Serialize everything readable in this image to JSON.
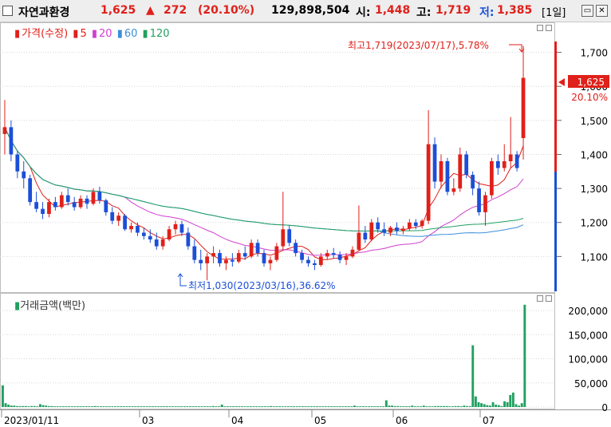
{
  "header": {
    "name": "자연과환경",
    "price": "1,625",
    "change_arrow": "▲",
    "change": "272",
    "change_pct": "(20.10%)",
    "volume": "129,898,504",
    "open_label": "시:",
    "open": "1,448",
    "high_label": "고:",
    "high": "1,719",
    "low_label": "저:",
    "low": "1,385",
    "period": "[1일]"
  },
  "legend": {
    "price_label": "가격(수정)",
    "ma": [
      "5",
      "20",
      "60",
      "120"
    ],
    "volume_label": "거래금액(백만)"
  },
  "annotations": {
    "high": "최고1,719(2023/07/17),5.78%",
    "low": "최저1,030(2023/03/16),36.62%",
    "current_price": "1,625",
    "current_pct": "20.10%"
  },
  "colors": {
    "up": "#e0201a",
    "down": "#1b4fd8",
    "ma5": "#e0201a",
    "ma20": "#d040d0",
    "ma60": "#3a8fd8",
    "ma120": "#22a060",
    "volume": "#22a060"
  },
  "chart_data": [
    {
      "type": "candlestick",
      "title": "가격(수정)",
      "y_ticks": [
        1100,
        1200,
        1300,
        1400,
        1500,
        1600,
        1700
      ],
      "ylim": [
        1000,
        1760
      ],
      "x_ticks": [
        "2023/01/11",
        "03",
        "04",
        "05",
        "06",
        "07"
      ],
      "series": [
        {
          "name": "5",
          "values": []
        },
        {
          "name": "20",
          "values": []
        },
        {
          "name": "60",
          "values": []
        },
        {
          "name": "120",
          "values": []
        }
      ],
      "key_points": [
        {
          "label": "최고",
          "date": "2023/07/17",
          "value": 1719
        },
        {
          "label": "최저",
          "date": "2023/03/16",
          "value": 1030
        },
        {
          "label": "현재가",
          "value": 1625
        }
      ],
      "candles": [
        [
          1460,
          1560,
          1400,
          1480
        ],
        [
          1480,
          1500,
          1380,
          1400
        ],
        [
          1400,
          1410,
          1330,
          1350
        ],
        [
          1350,
          1380,
          1300,
          1330
        ],
        [
          1330,
          1340,
          1250,
          1260
        ],
        [
          1260,
          1290,
          1230,
          1240
        ],
        [
          1240,
          1260,
          1210,
          1225
        ],
        [
          1225,
          1270,
          1215,
          1260
        ],
        [
          1260,
          1275,
          1235,
          1245
        ],
        [
          1245,
          1290,
          1240,
          1280
        ],
        [
          1280,
          1300,
          1250,
          1260
        ],
        [
          1260,
          1275,
          1235,
          1245
        ],
        [
          1245,
          1280,
          1240,
          1270
        ],
        [
          1270,
          1280,
          1240,
          1255
        ],
        [
          1255,
          1300,
          1250,
          1290
        ],
        [
          1290,
          1305,
          1255,
          1265
        ],
        [
          1265,
          1270,
          1220,
          1230
        ],
        [
          1230,
          1245,
          1195,
          1205
        ],
        [
          1205,
          1230,
          1190,
          1220
        ],
        [
          1220,
          1225,
          1175,
          1180
        ],
        [
          1180,
          1200,
          1170,
          1190
        ],
        [
          1190,
          1200,
          1160,
          1170
        ],
        [
          1170,
          1185,
          1150,
          1160
        ],
        [
          1160,
          1180,
          1140,
          1150
        ],
        [
          1150,
          1170,
          1120,
          1130
        ],
        [
          1130,
          1160,
          1120,
          1150
        ],
        [
          1150,
          1190,
          1145,
          1180
        ],
        [
          1180,
          1205,
          1165,
          1195
        ],
        [
          1195,
          1205,
          1160,
          1170
        ],
        [
          1170,
          1185,
          1120,
          1130
        ],
        [
          1130,
          1150,
          1080,
          1090
        ],
        [
          1090,
          1120,
          1060,
          1080
        ],
        [
          1080,
          1110,
          1030,
          1100
        ],
        [
          1100,
          1130,
          1080,
          1110
        ],
        [
          1110,
          1120,
          1070,
          1080
        ],
        [
          1080,
          1100,
          1060,
          1090
        ],
        [
          1090,
          1110,
          1070,
          1085
        ],
        [
          1085,
          1120,
          1080,
          1110
        ],
        [
          1110,
          1130,
          1090,
          1100
        ],
        [
          1100,
          1150,
          1095,
          1140
        ],
        [
          1140,
          1150,
          1100,
          1110
        ],
        [
          1110,
          1120,
          1070,
          1080
        ],
        [
          1080,
          1100,
          1060,
          1090
        ],
        [
          1090,
          1140,
          1085,
          1130
        ],
        [
          1130,
          1290,
          1120,
          1180
        ],
        [
          1180,
          1190,
          1130,
          1140
        ],
        [
          1140,
          1150,
          1100,
          1110
        ],
        [
          1110,
          1120,
          1080,
          1090
        ],
        [
          1090,
          1100,
          1070,
          1080
        ],
        [
          1080,
          1090,
          1060,
          1075
        ],
        [
          1075,
          1110,
          1070,
          1100
        ],
        [
          1100,
          1120,
          1090,
          1110
        ],
        [
          1110,
          1125,
          1095,
          1105
        ],
        [
          1105,
          1115,
          1080,
          1090
        ],
        [
          1090,
          1110,
          1075,
          1100
        ],
        [
          1100,
          1130,
          1095,
          1120
        ],
        [
          1120,
          1250,
          1115,
          1170
        ],
        [
          1170,
          1190,
          1140,
          1150
        ],
        [
          1150,
          1210,
          1145,
          1200
        ],
        [
          1200,
          1215,
          1170,
          1180
        ],
        [
          1180,
          1200,
          1160,
          1170
        ],
        [
          1170,
          1190,
          1160,
          1185
        ],
        [
          1185,
          1200,
          1165,
          1175
        ],
        [
          1175,
          1190,
          1165,
          1182
        ],
        [
          1182,
          1210,
          1175,
          1200
        ],
        [
          1200,
          1210,
          1180,
          1190
        ],
        [
          1190,
          1210,
          1182,
          1205
        ],
        [
          1205,
          1530,
          1195,
          1430
        ],
        [
          1430,
          1450,
          1300,
          1320
        ],
        [
          1320,
          1400,
          1300,
          1380
        ],
        [
          1380,
          1390,
          1280,
          1290
        ],
        [
          1290,
          1330,
          1280,
          1300
        ],
        [
          1300,
          1420,
          1290,
          1400
        ],
        [
          1400,
          1410,
          1330,
          1340
        ],
        [
          1340,
          1350,
          1280,
          1300
        ],
        [
          1300,
          1320,
          1220,
          1230
        ],
        [
          1230,
          1290,
          1190,
          1280
        ],
        [
          1280,
          1390,
          1270,
          1380
        ],
        [
          1380,
          1400,
          1340,
          1360
        ],
        [
          1360,
          1430,
          1350,
          1380
        ],
        [
          1380,
          1510,
          1360,
          1400
        ],
        [
          1400,
          1410,
          1350,
          1360
        ],
        [
          1448,
          1719,
          1385,
          1625
        ]
      ]
    },
    {
      "type": "bar",
      "title": "거래금액(백만)",
      "y_ticks": [
        0,
        50000,
        100000,
        150000,
        200000
      ],
      "ylim": [
        0,
        215000
      ],
      "values": [
        45000,
        8000,
        5000,
        3000,
        3000,
        2000,
        2000,
        2000,
        2000,
        1500,
        2000,
        2000,
        1500,
        6000,
        4000,
        3000,
        2000,
        2000,
        1500,
        1500,
        1500,
        1500,
        1500,
        1500,
        1500,
        1500,
        1500,
        1500,
        1500,
        1500,
        1500,
        1500,
        2000,
        1500,
        1500,
        1500,
        1500,
        1500,
        1500,
        1500,
        1500,
        1500,
        1500,
        1500,
        1500,
        1500,
        1500,
        1500,
        1500,
        1500,
        1500,
        1500,
        1500,
        1500,
        1500,
        1500,
        1500,
        1500,
        1500,
        1500,
        1500,
        1500,
        1500,
        1500,
        1500,
        1500,
        1500,
        1500,
        1500,
        1500,
        1500,
        1500,
        1500,
        2000,
        1500,
        1500,
        5000,
        1500,
        1500,
        1500,
        1500,
        1500,
        1500,
        1500,
        1500,
        1500,
        1500,
        1500,
        1500,
        1500,
        1500,
        1500,
        1500,
        2000,
        1500,
        1500,
        1500,
        1500,
        1500,
        1500,
        1500,
        1500,
        1500,
        1500,
        1500,
        1500,
        1500,
        1500,
        1500,
        1500,
        1500,
        1500,
        1500,
        1500,
        1500,
        1500,
        1500,
        1500,
        1500,
        1500,
        1500,
        1500,
        3000,
        1500,
        1500,
        1500,
        1500,
        1500,
        1500,
        1500,
        1500,
        1500,
        1500,
        14000,
        3000,
        3000,
        2000,
        2000,
        1500,
        1500,
        1500,
        1500,
        3000,
        1500,
        1500,
        1500,
        3000,
        1500,
        1500,
        1500,
        2000,
        2000,
        2000,
        2000,
        2000,
        1500,
        1500,
        2000,
        2000,
        1500,
        3000,
        2000,
        2000,
        128000,
        22000,
        10000,
        8000,
        6000,
        4000,
        3000,
        10000,
        5000,
        4000,
        2000,
        12000,
        10000,
        25000,
        30000,
        6000,
        3000,
        8000,
        212000
      ]
    }
  ]
}
